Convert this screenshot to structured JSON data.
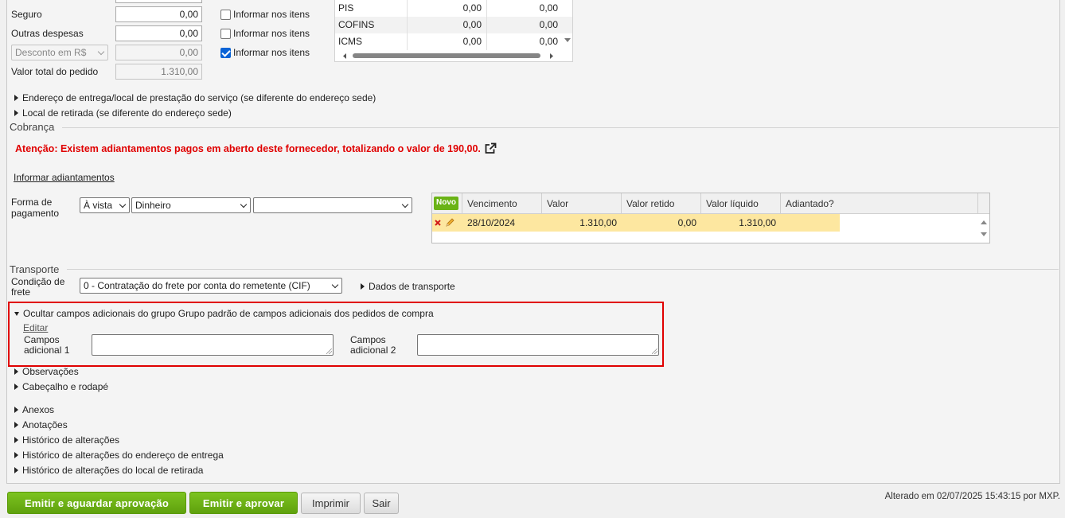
{
  "totals": {
    "seguro_label": "Seguro",
    "seguro_value": "0,00",
    "outras_label": "Outras despesas",
    "outras_value": "0,00",
    "desconto_select": "Desconto em R$",
    "desconto_value": "0,00",
    "valor_total_label": "Valor total do pedido",
    "valor_total_value": "1.310,00",
    "informar_label": "Informar nos itens",
    "informar_checks": [
      false,
      false,
      true
    ]
  },
  "tax_table": {
    "rows": [
      {
        "name": "PIS",
        "v1": "0,00",
        "v2": "0,00"
      },
      {
        "name": "COFINS",
        "v1": "0,00",
        "v2": "0,00"
      },
      {
        "name": "ICMS",
        "v1": "0,00",
        "v2": "0,00"
      }
    ]
  },
  "address": {
    "entrega": "Endereço de entrega/local de prestação do serviço (se diferente do endereço sede)",
    "retirada": "Local de retirada (se diferente do endereço sede)"
  },
  "cobranca": {
    "title": "Cobrança",
    "warning": "Atenção: Existem adiantamentos pagos em aberto deste fornecedor, totalizando o valor de 190,00.",
    "informar_adiantamentos": "Informar adiantamentos",
    "forma_label": "Forma de pagamento",
    "forma_select": "À vista",
    "meio_select": "Dinheiro",
    "extra_select": "",
    "grid": {
      "novo": "Novo",
      "headers": [
        "Vencimento",
        "Valor",
        "Valor retido",
        "Valor líquido",
        "Adiantado?"
      ],
      "row": {
        "vencimento": "28/10/2024",
        "valor": "1.310,00",
        "retido": "0,00",
        "liquido": "1.310,00",
        "adiantado": ""
      }
    }
  },
  "transporte": {
    "title": "Transporte",
    "condicao_label": "Condição de frete",
    "condicao_select": "0 - Contratação do frete por conta do remetente (CIF)",
    "dados_label": "Dados de transporte"
  },
  "campos": {
    "toggle": "Ocultar campos adicionais do grupo Grupo padrão de campos adicionais dos pedidos de compra",
    "editar": "Editar",
    "campo1_label": "Campos adicional 1",
    "campo2_label": "Campos adicional 2"
  },
  "sections": [
    "Observações",
    "Cabeçalho e rodapé",
    "Anexos",
    "Anotações",
    "Histórico de alterações",
    "Histórico de alterações do endereço de entrega",
    "Histórico de alterações do local de retirada"
  ],
  "footer": {
    "btn_emitir_aguardar": "Emitir e aguardar aprovação",
    "btn_emitir_aprovar": "Emitir e aprovar",
    "btn_imprimir": "Imprimir",
    "btn_sair": "Sair",
    "alterado": "Alterado em 02/07/2025 15:43:15 por MXP."
  },
  "colors": {
    "accent_green": "#6ab316",
    "warning_red": "#e00000",
    "highlight_border": "#e00000",
    "row_highlight": "#fde7a0"
  }
}
